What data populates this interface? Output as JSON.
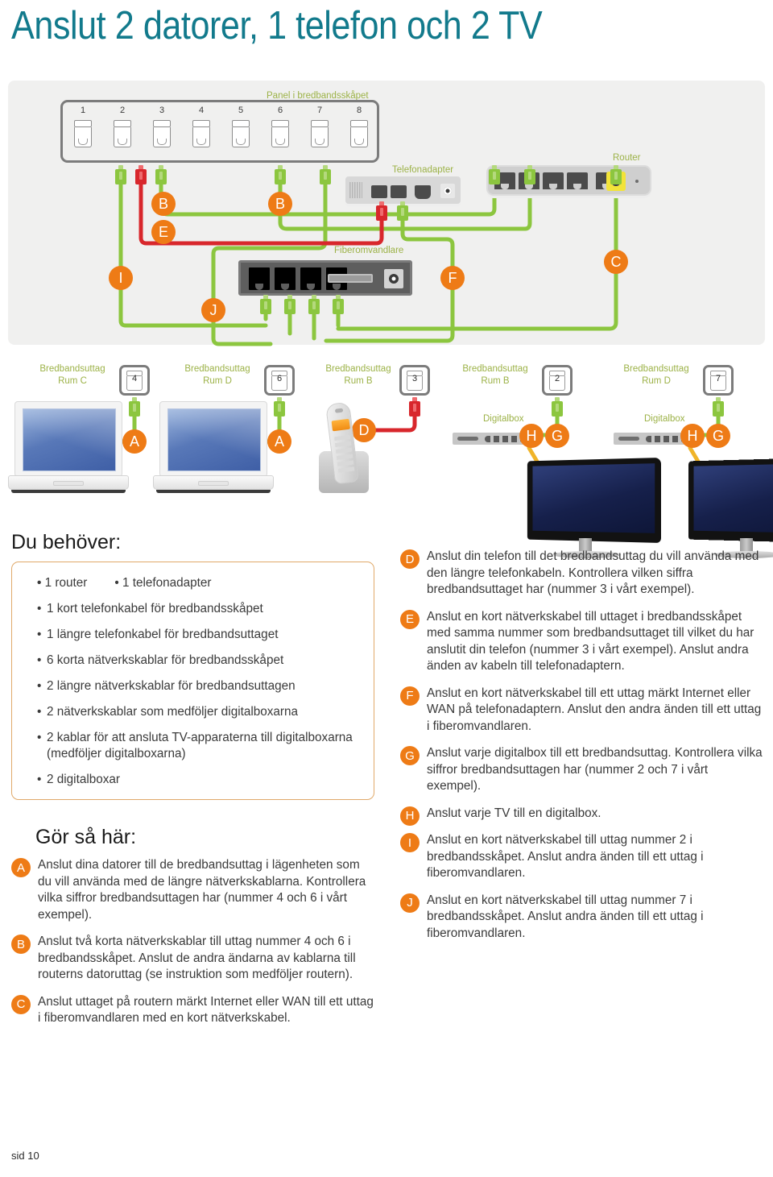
{
  "page": {
    "title": "Anslut 2 datorer, 1 telefon och 2 TV",
    "footer": "sid 10",
    "title_color": "#127a8c",
    "accent_orange": "#ee7b16",
    "cable_green": "#8cc63f",
    "cable_red": "#d8272c",
    "cable_yellow": "#f0b429",
    "label_green": "#9cb247"
  },
  "diagram": {
    "panel_caption": "Panel i bredbandsskåpet",
    "panel_ports": [
      "1",
      "2",
      "3",
      "4",
      "5",
      "6",
      "7",
      "8"
    ],
    "devices": [
      {
        "name": "Telefonadapter",
        "label": "Telefonadapter"
      },
      {
        "name": "Router",
        "label": "Router"
      },
      {
        "name": "Fiberomvandlare",
        "label": "Fiberomvandlare"
      }
    ],
    "cabinet_markers": [
      "B",
      "B",
      "E",
      "I",
      "J",
      "F",
      "C"
    ],
    "outlets": [
      {
        "title": "Bredbandsuttag",
        "room": "Rum C",
        "number": "4",
        "device": "dator",
        "marker": "A"
      },
      {
        "title": "Bredbandsuttag",
        "room": "Rum D",
        "number": "6",
        "device": "dator",
        "marker": "A"
      },
      {
        "title": "Bredbandsuttag",
        "room": "Rum B",
        "number": "3",
        "device": "telefon",
        "marker": "D"
      },
      {
        "title": "Bredbandsuttag",
        "room": "Rum B",
        "number": "2",
        "device": "digitalbox",
        "marker": "G"
      },
      {
        "title": "Bredbandsuttag",
        "room": "Rum D",
        "number": "7",
        "device": "digitalbox",
        "marker": "G"
      }
    ],
    "digitalbox_label": "Digitalbox",
    "tv_markers": [
      "H",
      "H"
    ]
  },
  "needs": {
    "heading": "Du behöver:",
    "items_inline": [
      "1 router",
      "1 telefonadapter"
    ],
    "items": [
      "1 kort telefonkabel för bredbandsskåpet",
      "1 längre telefonkabel för bredbandsuttaget",
      "6 korta nätverkskablar för bredbandsskåpet",
      "2 längre nätverkskablar för bredbandsuttagen",
      "2 nätverkskablar som medföljer digitalboxarna",
      "2 kablar för att ansluta TV-apparaterna till digitalboxarna (medföljer digitalboxarna)",
      "2 digitalboxar"
    ]
  },
  "howto": {
    "heading": "Gör så här:",
    "left": [
      {
        "letter": "A",
        "text": "Anslut dina datorer till de bredbandsuttag i lägenheten som du vill använda med de längre nätverkskablarna. Kontrollera vilka siffror bredbandsuttagen har (nummer 4 och 6 i vårt exempel)."
      },
      {
        "letter": "B",
        "text": "Anslut två korta nätverkskablar till uttag nummer 4 och 6 i bredbandsskåpet. Anslut de andra ändarna av kablarna till routerns datoruttag (se instruktion som medföljer routern)."
      },
      {
        "letter": "C",
        "text": "Anslut uttaget på routern märkt Internet eller WAN till ett uttag i fiberomvandlaren med en kort nätverkskabel."
      }
    ],
    "right": [
      {
        "letter": "D",
        "text": "Anslut din telefon till det bredbandsuttag du vill använda med den längre telefonkabeln. Kontrollera vilken siffra bredbandsuttaget har (nummer 3 i vårt exempel)."
      },
      {
        "letter": "E",
        "text": "Anslut en kort nätverkskabel till uttaget i bredbandsskåpet med samma nummer som bredbandsuttaget till vilket du har anslutit din telefon (nummer 3 i vårt exempel). Anslut andra änden av kabeln till telefonadaptern."
      },
      {
        "letter": "F",
        "text": "Anslut en kort nätverkskabel till ett uttag märkt Internet eller WAN på telefonadaptern. Anslut den andra änden till ett uttag i fiberomvandlaren."
      },
      {
        "letter": "G",
        "text": "Anslut varje digitalbox till ett bredbandsuttag. Kontrollera vilka siffror bredbandsuttagen har (nummer 2 och 7 i vårt exempel)."
      },
      {
        "letter": "H",
        "text": "Anslut varje TV till en digitalbox."
      },
      {
        "letter": "I",
        "text": "Anslut en kort nätverkskabel till uttag nummer 2 i bredbandsskåpet. Anslut andra änden till ett uttag i fiberomvandlaren."
      },
      {
        "letter": "J",
        "text": "Anslut en kort nätverkskabel till uttag nummer 7 i bredbandsskåpet. Anslut andra änden till ett uttag i fiberomvandlaren."
      }
    ]
  }
}
